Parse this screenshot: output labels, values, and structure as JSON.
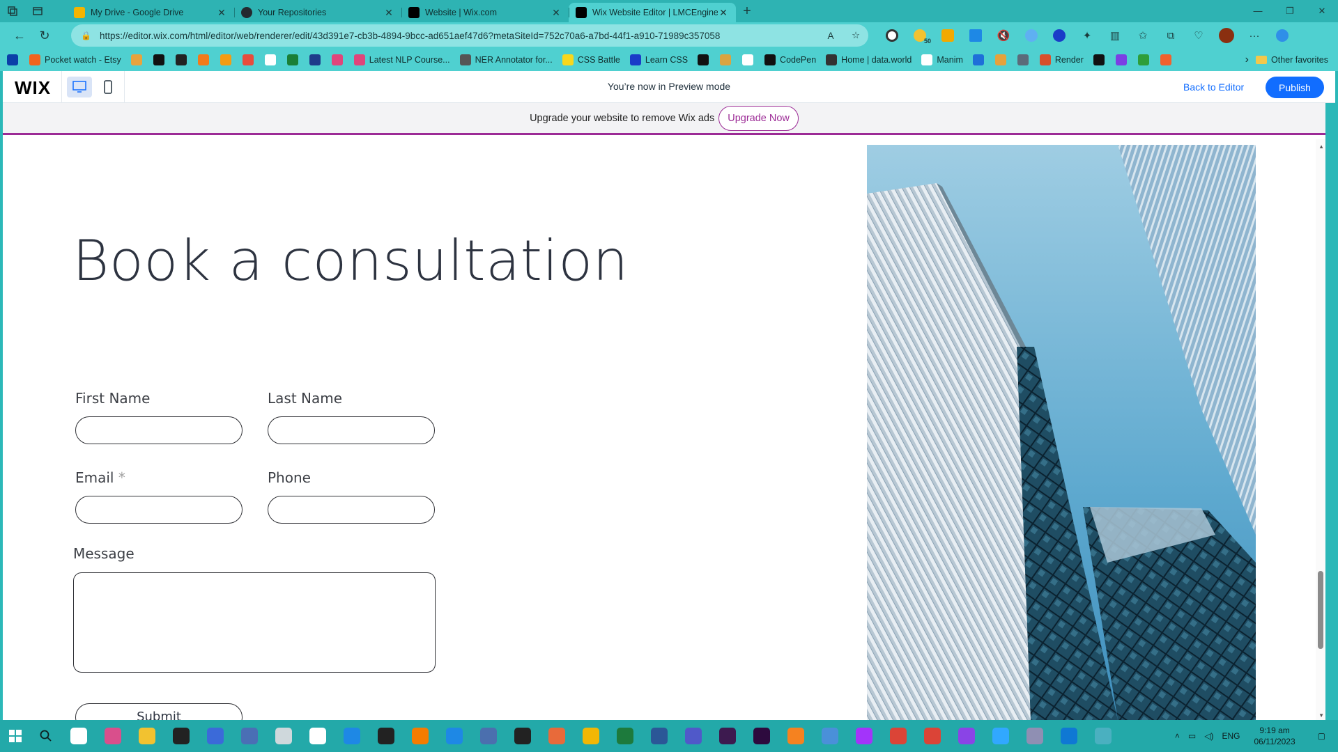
{
  "browser": {
    "tabs": [
      {
        "title": "My Drive - Google Drive",
        "favicon_color": "#f4b400",
        "active": false
      },
      {
        "title": "Your Repositories",
        "favicon_color": "#24292f",
        "active": false
      },
      {
        "title": "Website | Wix.com",
        "favicon_color": "#000000",
        "active": false
      },
      {
        "title": "Wix Website Editor | LMCEngine",
        "favicon_color": "#000000",
        "active": true
      }
    ],
    "url": "https://editor.wix.com/html/editor/web/renderer/edit/43d391e7-cb3b-4894-9bcc-ad651aef47d6?metaSiteId=752c70a6-a7bd-44f1-a910-71989c357058",
    "extensions_badge": "50",
    "bookmarks": [
      {
        "label": "",
        "icon": "play-icon",
        "color": "#0b3fa8"
      },
      {
        "label": "Pocket watch - Etsy",
        "icon": "etsy-icon",
        "color": "#f1641e"
      },
      {
        "label": "",
        "icon": "bar-icon",
        "color": "#e8a33d"
      },
      {
        "label": "",
        "icon": "amazon-icon",
        "color": "#111111"
      },
      {
        "label": "",
        "icon": "notion-icon",
        "color": "#222222"
      },
      {
        "label": "",
        "icon": "box-icon",
        "color": "#f27a1a"
      },
      {
        "label": "",
        "icon": "arrow-icon",
        "color": "#f39c12"
      },
      {
        "label": "",
        "icon": "drop-icon",
        "color": "#e74c3c"
      },
      {
        "label": "",
        "icon": "page-icon",
        "color": "#ffffff"
      },
      {
        "label": "",
        "icon": "circle-icon",
        "color": "#1a7f37"
      },
      {
        "label": "",
        "icon": "n-icon",
        "color": "#1e3a8a"
      },
      {
        "label": "",
        "icon": "dots-icon",
        "color": "#e0457b"
      },
      {
        "label": "Latest NLP Course...",
        "icon": "nlp-icon",
        "color": "#e0457b"
      },
      {
        "label": "NER Annotator for...",
        "icon": "ner-icon",
        "color": "#555555"
      },
      {
        "label": "CSS Battle",
        "icon": "cssbattle-icon",
        "color": "#f9d71c"
      },
      {
        "label": "Learn CSS",
        "icon": "learncss-icon",
        "color": "#1a3cc8"
      },
      {
        "label": "",
        "icon": "code-icon",
        "color": "#111111"
      },
      {
        "label": "",
        "icon": "leaf-icon",
        "color": "#d9a441"
      },
      {
        "label": "",
        "icon": "square-icon",
        "color": "#ffffff"
      },
      {
        "label": "CodePen",
        "icon": "codepen-icon",
        "color": "#111111"
      },
      {
        "label": "Home | data.world",
        "icon": "dataworld-icon",
        "color": "#333333"
      },
      {
        "label": "Manim",
        "icon": "manim-icon",
        "color": "#ffffff"
      },
      {
        "label": "",
        "icon": "k-icon",
        "color": "#1e6fd9"
      },
      {
        "label": "",
        "icon": "glasses-icon",
        "color": "#e6a23c"
      },
      {
        "label": "",
        "icon": "grid-icon",
        "color": "#5b6b7a"
      },
      {
        "label": "Render",
        "icon": "render-icon",
        "color": "#d94f2b"
      },
      {
        "label": "",
        "icon": "a-icon",
        "color": "#111111"
      },
      {
        "label": "",
        "icon": "h-icon",
        "color": "#7b3fe4"
      },
      {
        "label": "",
        "icon": "w-icon",
        "color": "#2e9e3a"
      },
      {
        "label": "",
        "icon": "orange-icon",
        "color": "#f0612d"
      }
    ],
    "other_favorites": "Other favorites"
  },
  "wix": {
    "logo": "WIX",
    "preview_text": "You’re now in Preview mode",
    "back_to_editor": "Back to Editor",
    "publish": "Publish",
    "ad_text": "Upgrade your website to remove Wix ads",
    "upgrade_now": "Upgrade Now"
  },
  "page": {
    "heading": "Book a consultation",
    "form": {
      "first_name": "First Name",
      "last_name": "Last Name",
      "email": "Email",
      "email_required": "*",
      "phone": "Phone",
      "message": "Message",
      "submit": "Submit"
    }
  },
  "taskbar": {
    "apps": [
      "#ffffff",
      "#d94f8c",
      "#f2c230",
      "#222222",
      "#3b6ad9",
      "#4a6fb5",
      "#cfd8dc",
      "#ffffff",
      "#1e88e5",
      "#222222",
      "#f57c00",
      "#1e88e5",
      "#4b6fae",
      "#222222",
      "#e86a3a",
      "#f2b705",
      "#1d7a3c",
      "#2b5797",
      "#5059c9",
      "#3d1a4f",
      "#2d0a3e",
      "#f58220",
      "#4a90d9",
      "#a334fa",
      "#db4437",
      "#db4437",
      "#8a44e6",
      "#31a8ff",
      "#8f8fb3",
      "#0f78d4",
      "#4ab0c0"
    ],
    "lang": "ENG",
    "time": "9:19 am",
    "date": "06/11/2023"
  }
}
